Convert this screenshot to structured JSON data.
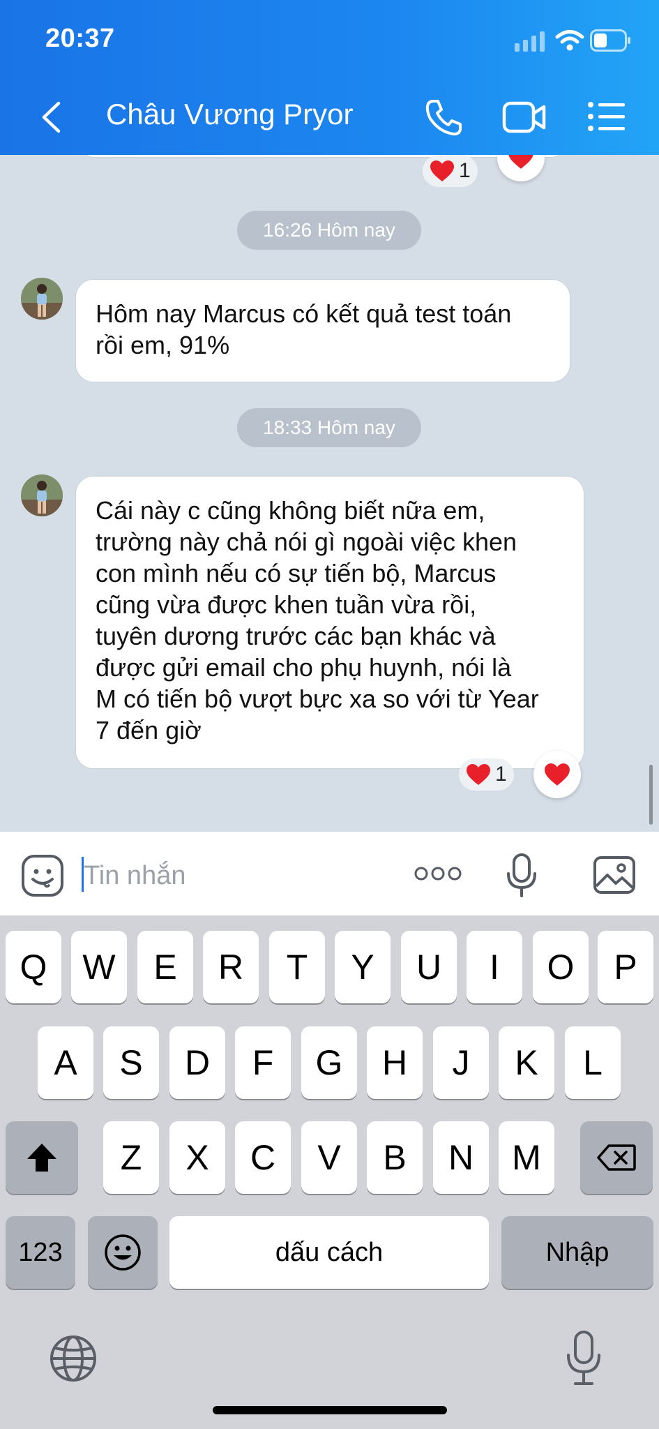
{
  "status_bar": {
    "time": "20:37"
  },
  "header": {
    "contact_name": "Châu Vương Pryor"
  },
  "chat": {
    "top_reaction_count": "1",
    "messages": [
      {
        "time_label": "16:26 Hôm nay",
        "text": "Hôm nay Marcus có kết quả test toán\nrồi em, 91%"
      },
      {
        "time_label": "18:33 Hôm nay",
        "text": "Cái này c cũng không biết nữa em,\ntrường này chả nói gì ngoài việc khen\ncon mình nếu có sự tiến bộ, Marcus\ncũng vừa được khen tuần vừa rồi,\ntuyên dương trước các bạn khác và\nđược gửi email cho phụ huynh, nói là\nM có tiến bộ vượt bực xa so với từ Year\n7 đến giờ",
        "reaction_count": "1"
      }
    ]
  },
  "input": {
    "placeholder": "Tin nhắn"
  },
  "keyboard": {
    "row1": [
      "Q",
      "W",
      "E",
      "R",
      "T",
      "Y",
      "U",
      "I",
      "O",
      "P"
    ],
    "row2": [
      "A",
      "S",
      "D",
      "F",
      "G",
      "H",
      "J",
      "K",
      "L"
    ],
    "row3": [
      "Z",
      "X",
      "C",
      "V",
      "B",
      "N",
      "M"
    ],
    "numbers_label": "123",
    "space_label": "dấu cách",
    "return_label": "Nhập"
  },
  "colors": {
    "header_start": "#1a74e6",
    "header_end": "#22a4f6",
    "heart": "#e8202a",
    "chat_bg": "#d5dde6"
  }
}
